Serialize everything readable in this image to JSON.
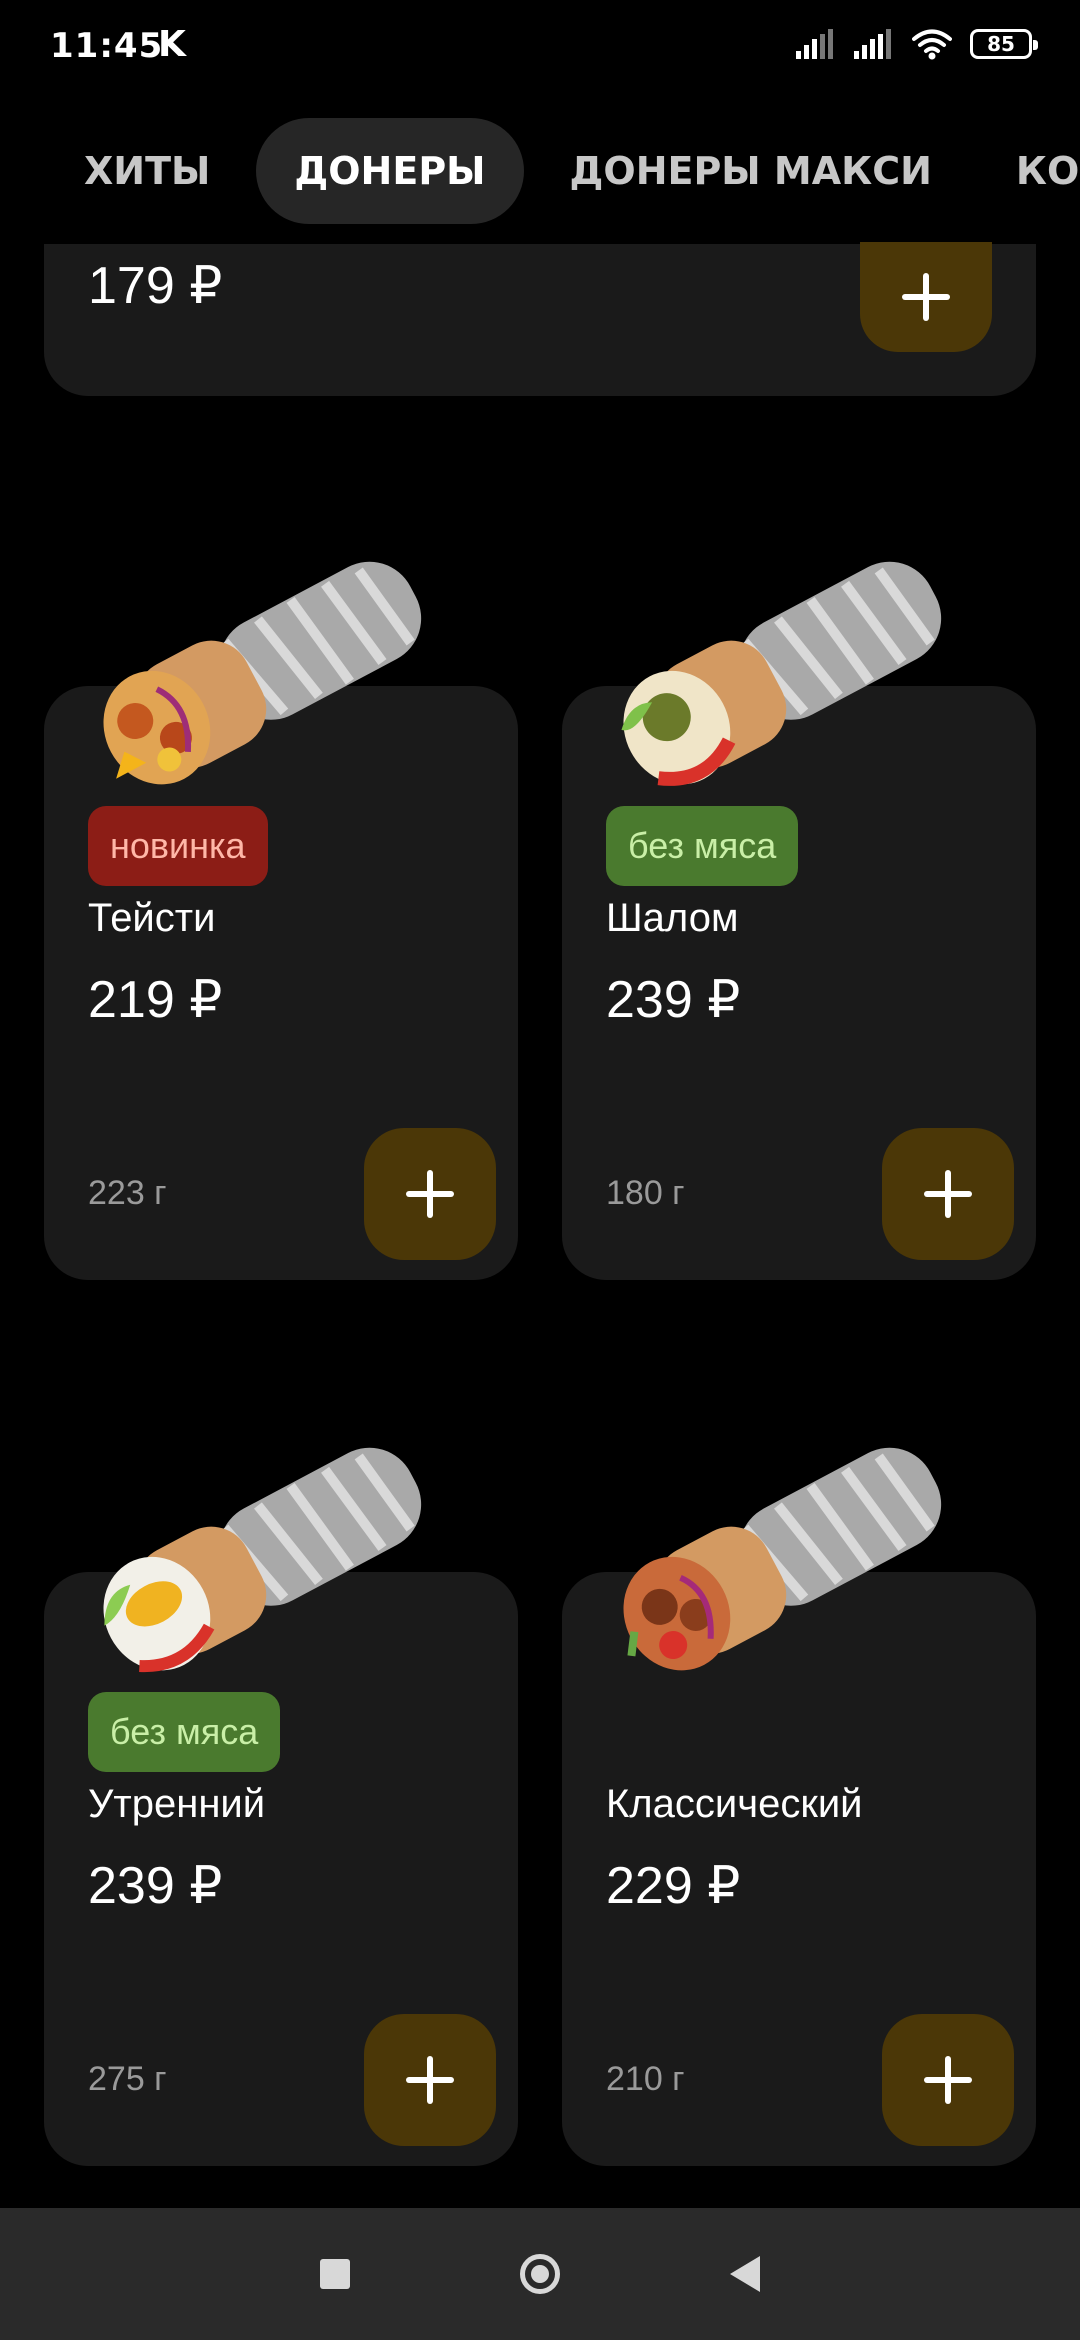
{
  "status_bar": {
    "time": "11:45",
    "extra": "K",
    "battery": "85"
  },
  "tabs": [
    {
      "label": "ХИТЫ"
    },
    {
      "label": "ДОНЕРЫ"
    },
    {
      "label": "ДОНЕРЫ МАКСИ"
    },
    {
      "label": "КОМ"
    }
  ],
  "partial_card": {
    "price": "179 ₽"
  },
  "products": [
    {
      "name": "Тейсти",
      "price": "219 ₽",
      "weight": "223 г",
      "badge": "новинка"
    },
    {
      "name": "Шалом",
      "price": "239 ₽",
      "weight": "180 г",
      "badge": "без мяса"
    },
    {
      "name": "Утренний",
      "price": "239 ₽",
      "weight": "275 г",
      "badge": "без мяса"
    },
    {
      "name": "Классический",
      "price": "229 ₽",
      "weight": "210 г",
      "badge": ""
    }
  ],
  "colors": {
    "background": "#000000",
    "card": "#1a1a1a",
    "add_button": "#4b3707",
    "badge_new": "#8c1d16",
    "badge_veg": "#4a7a2e"
  },
  "icons": {
    "signal": "signal-icon",
    "wifi": "wifi-icon",
    "battery": "battery-icon",
    "add": "plus-icon",
    "nav_recents": "square-icon",
    "nav_home": "circle-icon",
    "nav_back": "back-triangle-icon"
  }
}
